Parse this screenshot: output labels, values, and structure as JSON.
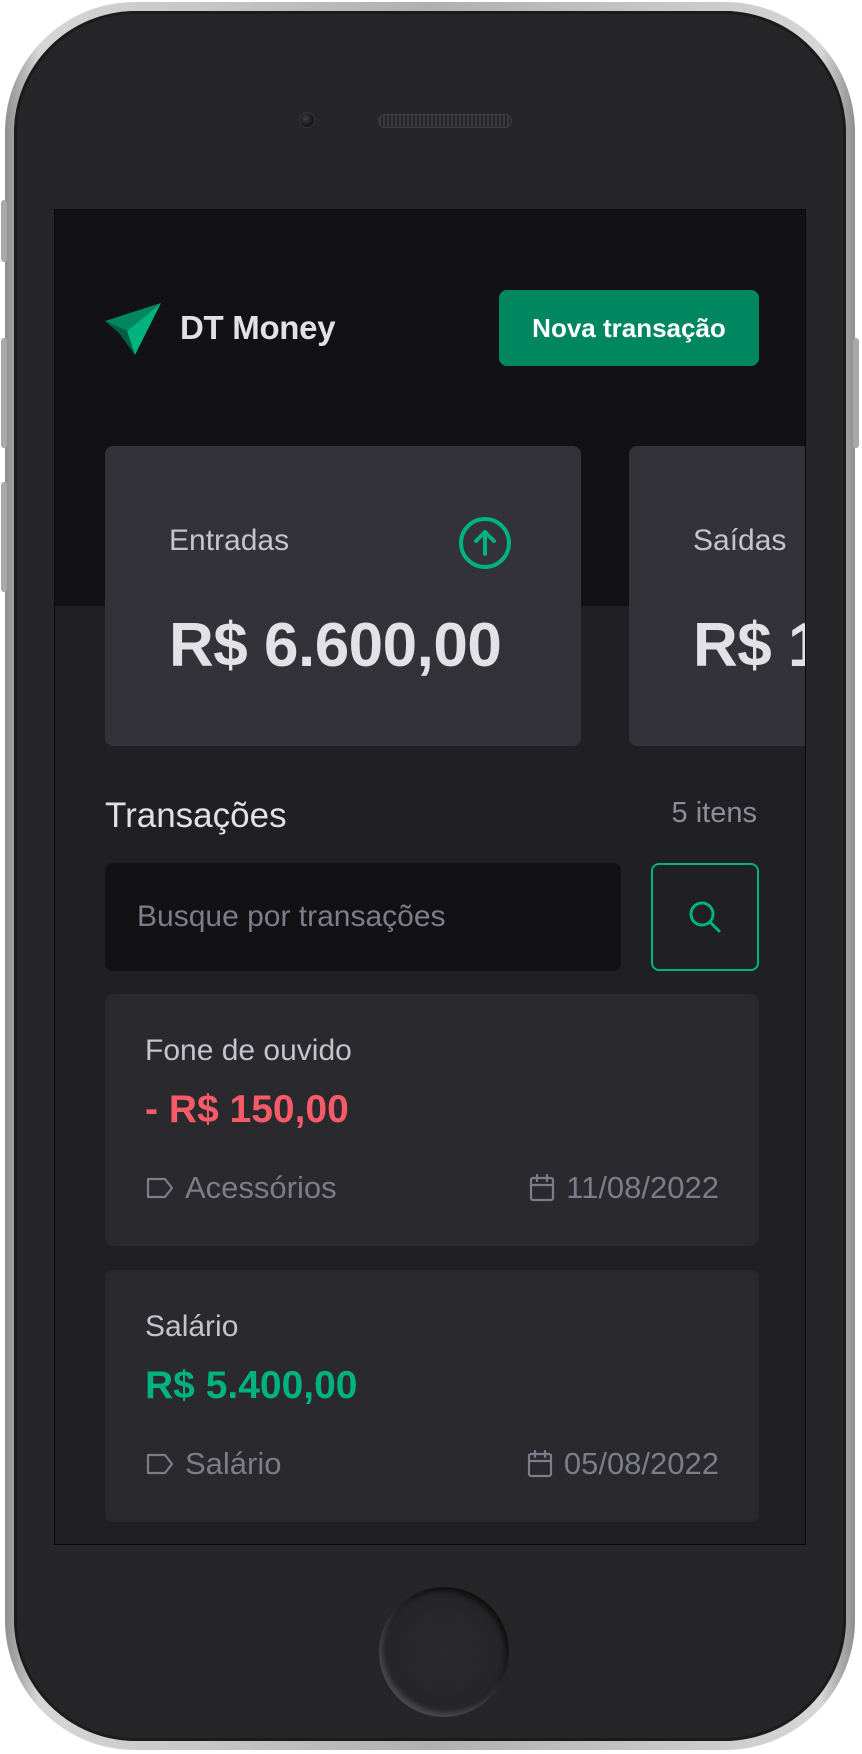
{
  "header": {
    "brand": "DT Money",
    "new_transaction_label": "Nova transação"
  },
  "summary": [
    {
      "label": "Entradas",
      "value": "R$ 6.600,00",
      "icon": "arrow-circle-up-icon",
      "color": "#00b37e"
    },
    {
      "label": "Saídas",
      "value": "R$ 1"
    }
  ],
  "transactions": {
    "title": "Transações",
    "count": "5 itens",
    "search_placeholder": "Busque por transações",
    "items": [
      {
        "description": "Fone de ouvido",
        "price": "- R$ 150,00",
        "type": "outcome",
        "category": "Acessórios",
        "date": "11/08/2022"
      },
      {
        "description": "Salário",
        "price": "R$ 5.400,00",
        "type": "income",
        "category": "Salário",
        "date": "05/08/2022"
      }
    ]
  },
  "colors": {
    "accent": "#00875f",
    "accent_light": "#00b37e",
    "outcome_red": "#f75a68",
    "background": "#202024",
    "header_bg": "#121214",
    "card_bg": "#29292e"
  }
}
